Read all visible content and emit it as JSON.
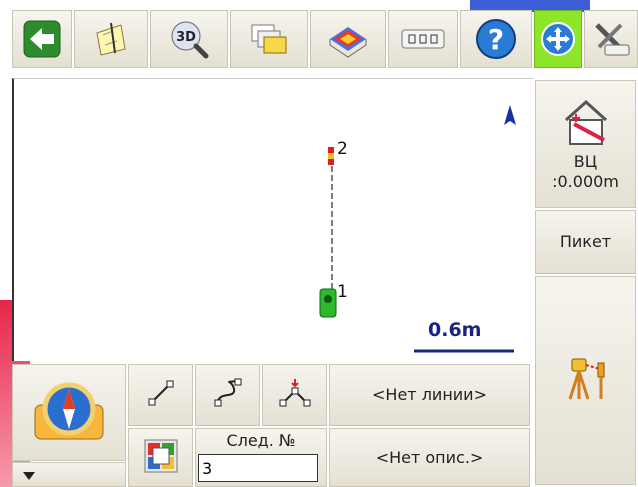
{
  "toolbar": {
    "buttons": [
      {
        "name": "back-button",
        "icon": "back-arrow-icon"
      },
      {
        "name": "map-edit-button",
        "icon": "map-edit-icon"
      },
      {
        "name": "3d-view-button",
        "icon": "3d-zoom-icon",
        "text": "3D"
      },
      {
        "name": "layers-button",
        "icon": "layers-icon"
      },
      {
        "name": "surface-button",
        "icon": "surface-icon"
      },
      {
        "name": "keyboard-button",
        "icon": "keyboard-icon"
      },
      {
        "name": "help-button",
        "icon": "help-icon",
        "text": "?"
      },
      {
        "name": "pan-button",
        "icon": "pan-move-icon"
      },
      {
        "name": "settings-button",
        "icon": "settings-tools-icon"
      }
    ]
  },
  "map": {
    "points": [
      {
        "label": "2"
      },
      {
        "label": "1"
      }
    ],
    "scale": "0.6m"
  },
  "side_panel": {
    "instrument_height_label": "ВЦ",
    "instrument_height_value": ":0.000m",
    "stake_label": "Пикет"
  },
  "bottom": {
    "next_label": "След. №",
    "next_value": "3",
    "no_line": "<Нет линии>",
    "no_desc": "<Нет опис.>"
  },
  "colors": {
    "accent_green": "#8ee62a",
    "brand_red": "#e8244a",
    "brand_blue": "#3c5fd8",
    "scale_blue": "#1a237e"
  }
}
